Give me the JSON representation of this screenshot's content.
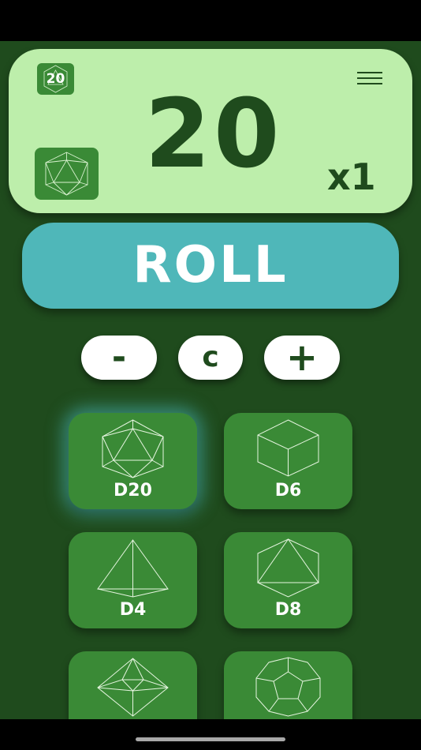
{
  "display": {
    "badge_label": "20",
    "result": "20",
    "multiplier": "x1"
  },
  "roll": {
    "label": "ROLL"
  },
  "controls": {
    "minus": "-",
    "clear": "c",
    "plus": "+"
  },
  "dice": [
    {
      "label": "D20",
      "selected": true
    },
    {
      "label": "D6",
      "selected": false
    },
    {
      "label": "D4",
      "selected": false
    },
    {
      "label": "D8",
      "selected": false
    },
    {
      "label": "",
      "selected": false
    },
    {
      "label": "",
      "selected": false
    }
  ],
  "colors": {
    "background": "#1f4b1d",
    "panel": "#bdeeab",
    "roll_button": "#4fb7b9",
    "die_card": "#3a8a36"
  },
  "icons": [
    "d20-badge-icon",
    "menu-icon",
    "d20-thumb-icon",
    "d20-icon",
    "d6-icon",
    "d4-icon",
    "d8-icon",
    "d10-icon",
    "d12-icon"
  ]
}
